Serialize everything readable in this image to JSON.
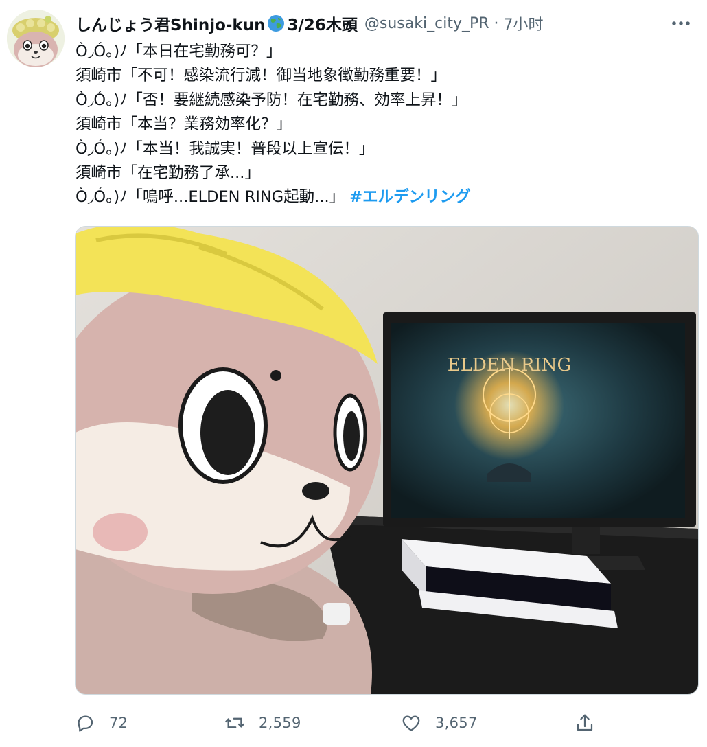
{
  "tweet": {
    "author": {
      "name": "しんじょう君Shinjo-kun",
      "name_suffix": "3/26木頭",
      "handle": "@susaki_city_PR",
      "separator": "·",
      "time": "7小时"
    },
    "lines": [
      "Ò◞Ó。)ﾉ「本日在宅勤務可？」",
      "須崎市「不可！感染流行減！御当地象徴勤務重要！」",
      "Ò◞Ó。)ﾉ「否！要継続感染予防！在宅勤務、効率上昇！」",
      "須崎市「本当？業務効率化？」",
      "Ò◞Ó。)ﾉ「本当！我誠実！普段以上宣伝！」",
      "須崎市「在宅勤務了承...」"
    ],
    "last_line": "Ò◞Ó。)ﾉ「嗚呼...ELDEN RING起動...」",
    "hashtag": "#エルデンリング",
    "media": {
      "screen_title": "ELDEN RING"
    },
    "actions": {
      "reply_count": "72",
      "retweet_count": "2,559",
      "like_count": "3,657"
    },
    "icons": {
      "more": "more-horizontal-icon",
      "reply": "reply-icon",
      "retweet": "retweet-icon",
      "like": "heart-icon",
      "share": "share-icon",
      "globe": "globe-emoji-icon"
    },
    "colors": {
      "text": "#0f1419",
      "secondary": "#536471",
      "accent": "#1d9bf0"
    }
  }
}
